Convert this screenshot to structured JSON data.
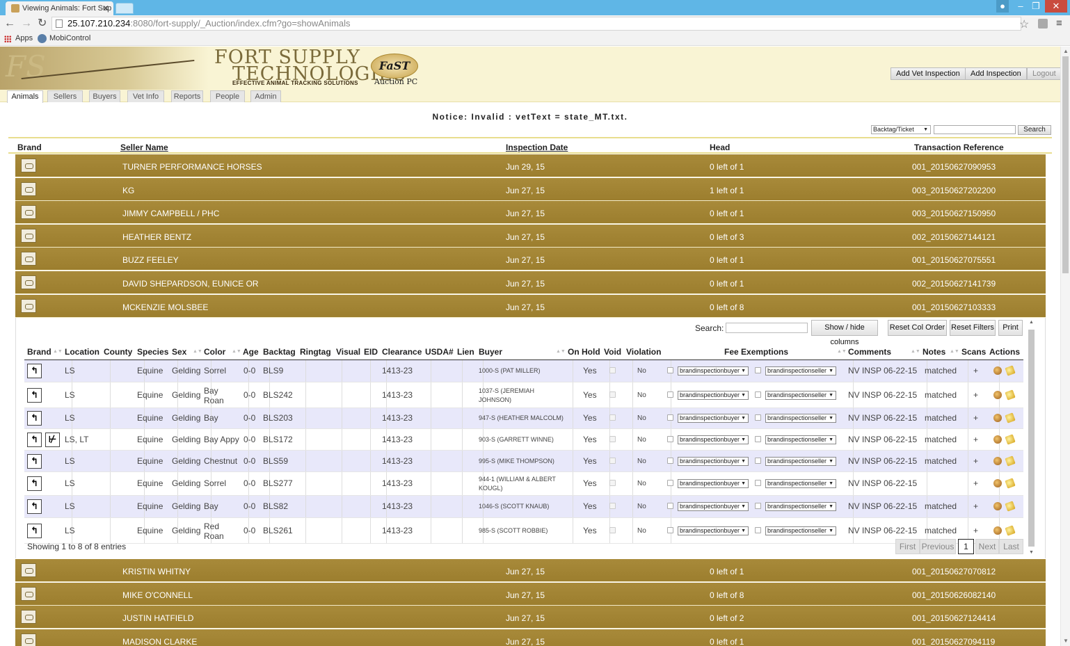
{
  "browser": {
    "tab_title": "Viewing Animals: Fort Sup",
    "url_host": "25.107.210.234",
    "url_rest": ":8080/fort-supply/_Auction/index.cfm?go=showAnimals",
    "bookmarks": [
      "Apps",
      "MobiControl"
    ]
  },
  "header": {
    "logo_line1": "FORT SUPPLY",
    "logo_line2": "TECHNOLOGIES",
    "tagline": "EFFECTIVE ANIMAL TRACKING SOLUTIONS",
    "fast_logo": "FaST",
    "auction_label": "Auction PC",
    "buttons": {
      "add_vet": "Add Vet Inspection",
      "add_inspection": "Add Inspection",
      "logout": "Logout"
    }
  },
  "nav_tabs": [
    "Animals",
    "Sellers",
    "Buyers",
    "Vet Info",
    "Reports",
    "People",
    "Admin"
  ],
  "notice": "Notice: Invalid : vetText = state_MT.txt.",
  "search": {
    "select_value": "Backtag/Ticket",
    "button": "Search"
  },
  "outer_table": {
    "headers": {
      "brand": "Brand",
      "seller": "Seller Name",
      "date": "Inspection Date",
      "head": "Head",
      "ref": "Transaction Reference"
    },
    "rows_top": [
      {
        "seller": "TURNER PERFORMANCE HORSES",
        "date": "Jun 29, 15",
        "head": "0 left of 1",
        "ref": "001_20150627090953"
      },
      {
        "seller": "KG",
        "date": "Jun 27, 15",
        "head": "1 left of 1",
        "ref": "003_20150627202200"
      },
      {
        "seller": "JIMMY CAMPBELL / PHC",
        "date": "Jun 27, 15",
        "head": "0 left of 1",
        "ref": "003_20150627150950"
      },
      {
        "seller": "HEATHER BENTZ",
        "date": "Jun 27, 15",
        "head": "0 left of 3",
        "ref": "002_20150627144121"
      },
      {
        "seller": "BUZZ FEELEY",
        "date": "Jun 27, 15",
        "head": "0 left of 1",
        "ref": "001_20150627075551"
      },
      {
        "seller": "DAVID SHEPARDSON, EUNICE OR",
        "date": "Jun 27, 15",
        "head": "0 left of 1",
        "ref": "002_20150627141739"
      },
      {
        "seller": "MCKENZIE MOLSBEE",
        "date": "Jun 27, 15",
        "head": "0 left of 8",
        "ref": "001_20150627103333"
      }
    ],
    "rows_bottom": [
      {
        "seller": "KRISTIN WHITNY",
        "date": "Jun 27, 15",
        "head": "0 left of 1",
        "ref": "001_20150627070812"
      },
      {
        "seller": "MIKE O'CONNELL",
        "date": "Jun 27, 15",
        "head": "0 left of 8",
        "ref": "001_20150626082140"
      },
      {
        "seller": "JUSTIN HATFIELD",
        "date": "Jun 27, 15",
        "head": "0 left of 2",
        "ref": "001_20150627124414"
      },
      {
        "seller": "MADISON CLARKE",
        "date": "Jun 27, 15",
        "head": "0 left of 1",
        "ref": "001_20150627094119"
      }
    ]
  },
  "detail": {
    "search_label": "Search:",
    "buttons": {
      "show_hide": "Show / hide columns",
      "reset_col": "Reset Col Order",
      "reset_filters": "Reset Filters",
      "print": "Print"
    },
    "headers": {
      "brand": "Brand",
      "location": "Location",
      "county": "County",
      "species": "Species",
      "sex": "Sex",
      "color": "Color",
      "age": "Age",
      "backtag": "Backtag",
      "ringtag": "Ringtag",
      "visual": "Visual",
      "eid": "EID",
      "clearance": "Clearance",
      "usda": "USDA#",
      "lien": "Lien",
      "buyer": "Buyer",
      "onhold": "On Hold",
      "void": "Void",
      "violation": "Violation",
      "fee": "Fee Exemptions",
      "comments": "Comments",
      "notes": "Notes",
      "scans": "Scans",
      "actions": "Actions"
    },
    "fee_buyer_option": "brandinspectionbuyer",
    "fee_seller_option": "brandinspectionseller",
    "rows": [
      {
        "brands": [
          "↰"
        ],
        "location": "LS",
        "species": "Equine",
        "sex": "Gelding",
        "color1": "Sorrel",
        "color2": "",
        "age": "0-0",
        "backtag": "BLS9",
        "clearance": "1413-23",
        "buyer1": "1000-S (PAT MILLER)",
        "buyer2": "",
        "onhold": "Yes",
        "violation": "No",
        "comments": "NV INSP 06-22-15",
        "notes": "matched",
        "scans": "+"
      },
      {
        "brands": [
          "↰"
        ],
        "location": "LS",
        "species": "Equine",
        "sex": "Gelding",
        "color1": "Bay",
        "color2": "Roan",
        "age": "0-0",
        "backtag": "BLS242",
        "clearance": "1413-23",
        "buyer1": "1037-S (JEREMIAH",
        "buyer2": "JOHNSON)",
        "onhold": "Yes",
        "violation": "No",
        "comments": "NV INSP 06-22-15",
        "notes": "matched",
        "scans": "+"
      },
      {
        "brands": [
          "↰"
        ],
        "location": "LS",
        "species": "Equine",
        "sex": "Gelding",
        "color1": "Bay",
        "color2": "",
        "age": "0-0",
        "backtag": "BLS203",
        "clearance": "1413-23",
        "buyer1": "947-S (HEATHER MALCOLM)",
        "buyer2": "",
        "onhold": "Yes",
        "violation": "No",
        "comments": "NV INSP 06-22-15",
        "notes": "matched",
        "scans": "+"
      },
      {
        "brands": [
          "↰",
          "⊬"
        ],
        "location": "LS, LT",
        "species": "Equine",
        "sex": "Gelding",
        "color1": "Bay Appy",
        "color2": "",
        "age": "0-0",
        "backtag": "BLS172",
        "clearance": "1413-23",
        "buyer1": "903-S (GARRETT WINNE)",
        "buyer2": "",
        "onhold": "Yes",
        "violation": "No",
        "comments": "NV INSP 06-22-15",
        "notes": "matched",
        "scans": "+"
      },
      {
        "brands": [
          "↰"
        ],
        "location": "LS",
        "species": "Equine",
        "sex": "Gelding",
        "color1": "Chestnut",
        "color2": "",
        "age": "0-0",
        "backtag": "BLS59",
        "clearance": "1413-23",
        "buyer1": "995-S (MIKE THOMPSON)",
        "buyer2": "",
        "onhold": "Yes",
        "violation": "No",
        "comments": "NV INSP 06-22-15",
        "notes": "matched",
        "scans": "+"
      },
      {
        "brands": [
          "↰"
        ],
        "location": "LS",
        "species": "Equine",
        "sex": "Gelding",
        "color1": "Sorrel",
        "color2": "",
        "age": "0-0",
        "backtag": "BLS277",
        "clearance": "1413-23",
        "buyer1": "944-1 (WILLIAM & ALBERT",
        "buyer2": "KOUGL)",
        "onhold": "Yes",
        "violation": "No",
        "comments": "NV INSP 06-22-15",
        "notes": "",
        "scans": "+"
      },
      {
        "brands": [
          "↰"
        ],
        "location": "LS",
        "species": "Equine",
        "sex": "Gelding",
        "color1": "Bay",
        "color2": "",
        "age": "0-0",
        "backtag": "BLS82",
        "clearance": "1413-23",
        "buyer1": "1046-S (SCOTT KNAUB)",
        "buyer2": "",
        "onhold": "Yes",
        "violation": "No",
        "comments": "NV INSP 06-22-15",
        "notes": "matched",
        "scans": "+"
      },
      {
        "brands": [
          "↰"
        ],
        "location": "LS",
        "species": "Equine",
        "sex": "Gelding",
        "color1": "Red",
        "color2": "Roan",
        "age": "0-0",
        "backtag": "BLS261",
        "clearance": "1413-23",
        "buyer1": "985-S (SCOTT ROBBIE)",
        "buyer2": "",
        "onhold": "Yes",
        "violation": "No",
        "comments": "NV INSP 06-22-15",
        "notes": "matched",
        "scans": "+"
      }
    ],
    "showing": "Showing 1 to 8 of 8 entries",
    "pager": {
      "first": "First",
      "previous": "Previous",
      "current": "1",
      "next": "Next",
      "last": "Last"
    }
  }
}
